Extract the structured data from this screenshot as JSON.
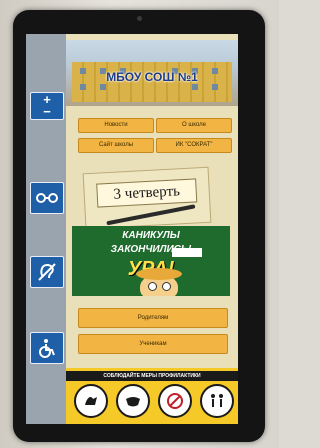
{
  "banner": {
    "title": "МБОУ СОШ №1"
  },
  "nav": {
    "news": "Новости",
    "about": "О школе",
    "site": "Сайт школы",
    "ik": "ИК \"СОКРАТ\""
  },
  "quarter_card": {
    "label": "3 четверть"
  },
  "poster": {
    "line1": "КАНИКУЛЫ",
    "line2": "ЗАКОНЧИЛИСЬ!",
    "line3": "УРА!"
  },
  "roles": {
    "parents": "Родителям",
    "students": "Ученикам"
  },
  "footer": {
    "title": "СОБЛЮДАЙТЕ МЕРЫ ПРОФИЛАКТИКИ"
  },
  "accessibility": {
    "zoom_plus": "+",
    "zoom_minus": "−",
    "icons": [
      "glasses-icon",
      "hearing-impaired-icon",
      "wheelchair-icon"
    ]
  },
  "colors": {
    "button": "#f2b544",
    "rail": "#9aa4ae",
    "rail_button": "#1f5fa8",
    "footer": "#f4c928"
  }
}
